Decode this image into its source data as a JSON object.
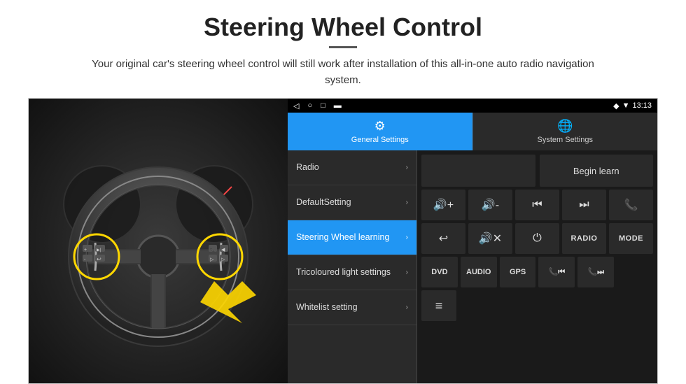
{
  "page": {
    "title": "Steering Wheel Control",
    "divider": true,
    "subtitle": "Your original car's steering wheel control will still work after installation of this all-in-one auto radio navigation system."
  },
  "status_bar": {
    "nav_icons": [
      "◁",
      "○",
      "□",
      "▬"
    ],
    "right_icons": "♦ ▼",
    "time": "13:13"
  },
  "tabs": [
    {
      "label": "General Settings",
      "icon": "⚙",
      "active": true
    },
    {
      "label": "System Settings",
      "icon": "🌐",
      "active": false
    }
  ],
  "menu": {
    "items": [
      {
        "label": "Radio",
        "active": false
      },
      {
        "label": "DefaultSetting",
        "active": false
      },
      {
        "label": "Steering Wheel learning",
        "active": true
      },
      {
        "label": "Tricoloured light settings",
        "active": false
      },
      {
        "label": "Whitelist setting",
        "active": false
      }
    ]
  },
  "right_panel": {
    "begin_learn_label": "Begin learn",
    "row1": [
      "vol+",
      "vol-",
      "prev",
      "next",
      "phone"
    ],
    "row2": [
      "hang",
      "mute",
      "power",
      "RADIO",
      "MODE"
    ],
    "row3": [
      "DVD",
      "AUDIO",
      "GPS",
      "tel+prev",
      "tel+next"
    ],
    "row4_icon": "≡"
  }
}
